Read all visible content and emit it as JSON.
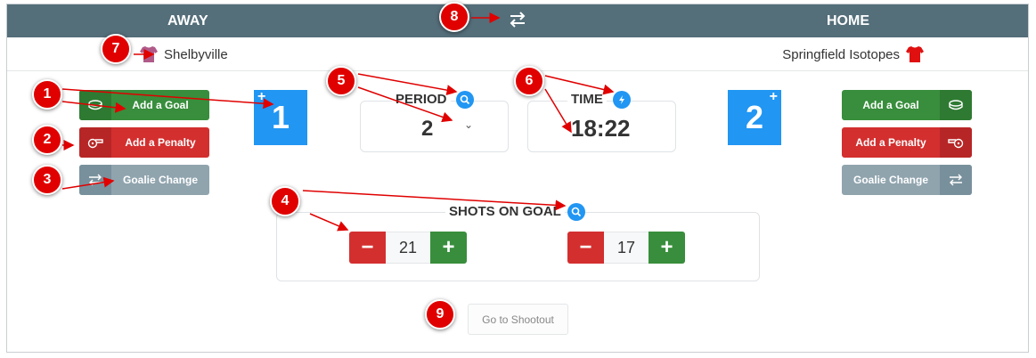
{
  "header": {
    "away_label": "AWAY",
    "home_label": "HOME",
    "swap_icon": "swap-arrows-icon"
  },
  "teams": {
    "away_name": "Shelbyville",
    "home_name": "Springfield Isotopes",
    "away_jersey_color": "#b05a8a",
    "home_jersey_color": "#e01010"
  },
  "away_actions": {
    "add_goal": "Add a Goal",
    "add_penalty": "Add a Penalty",
    "goalie_change": "Goalie Change"
  },
  "home_actions": {
    "add_goal": "Add a Goal",
    "add_penalty": "Add a Penalty",
    "goalie_change": "Goalie Change"
  },
  "scores": {
    "away": "1",
    "home": "2",
    "plus_symbol": "+"
  },
  "period": {
    "label": "PERIOD",
    "value": "2",
    "caret": "⌄"
  },
  "time": {
    "label": "TIME",
    "value": "18:22"
  },
  "shots": {
    "label": "SHOTS ON GOAL",
    "away": "21",
    "home": "17",
    "minus_symbol": "−",
    "plus_symbol": "+"
  },
  "shootout_button": "Go to Shootout",
  "callouts": [
    "1",
    "2",
    "3",
    "4",
    "5",
    "6",
    "7",
    "8",
    "9"
  ],
  "colors": {
    "header_bg": "#546e7a",
    "green": "#388e3c",
    "red": "#d32f2f",
    "gray": "#90a4ae",
    "blue": "#2196f3",
    "callout_red": "#e00000"
  }
}
